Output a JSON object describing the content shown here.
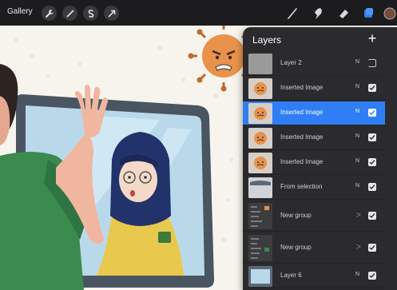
{
  "toolbar": {
    "gallery_label": "Gallery",
    "left_icons": [
      "wrench-icon",
      "magic-wand-icon",
      "selection-s-icon",
      "move-arrow-icon"
    ],
    "right_tools": [
      "brush-icon",
      "smudge-icon",
      "eraser-icon",
      "layers-icon",
      "color-icon"
    ]
  },
  "layers_panel": {
    "title": "Layers",
    "add_label": "+",
    "layers": [
      {
        "name": "Layer 2",
        "blend": "N",
        "visible": false,
        "selected": false,
        "thumb": "blank"
      },
      {
        "name": "Inserted Image",
        "blend": "N",
        "visible": true,
        "selected": false,
        "thumb": "virus"
      },
      {
        "name": "Inserted Image",
        "blend": "N",
        "visible": true,
        "selected": true,
        "thumb": "virus"
      },
      {
        "name": "Inserted Image",
        "blend": "N",
        "visible": true,
        "selected": false,
        "thumb": "virus"
      },
      {
        "name": "Inserted Image",
        "blend": "N",
        "visible": true,
        "selected": false,
        "thumb": "virus"
      },
      {
        "name": "From selection",
        "blend": "N",
        "visible": true,
        "selected": false,
        "thumb": "window"
      },
      {
        "name": "New group",
        "blend": ">",
        "visible": true,
        "selected": false,
        "thumb": "group"
      },
      {
        "name": "New group",
        "blend": ">",
        "visible": true,
        "selected": false,
        "thumb": "group"
      },
      {
        "name": "Layer 6",
        "blend": "N",
        "visible": true,
        "selected": false,
        "thumb": "window2"
      }
    ]
  },
  "colors": {
    "panel_bg": "#2b2b2d",
    "selected": "#2f7ef5",
    "toolbar_bg": "#1c1c1e",
    "accent_blue": "#2f7ef5"
  }
}
